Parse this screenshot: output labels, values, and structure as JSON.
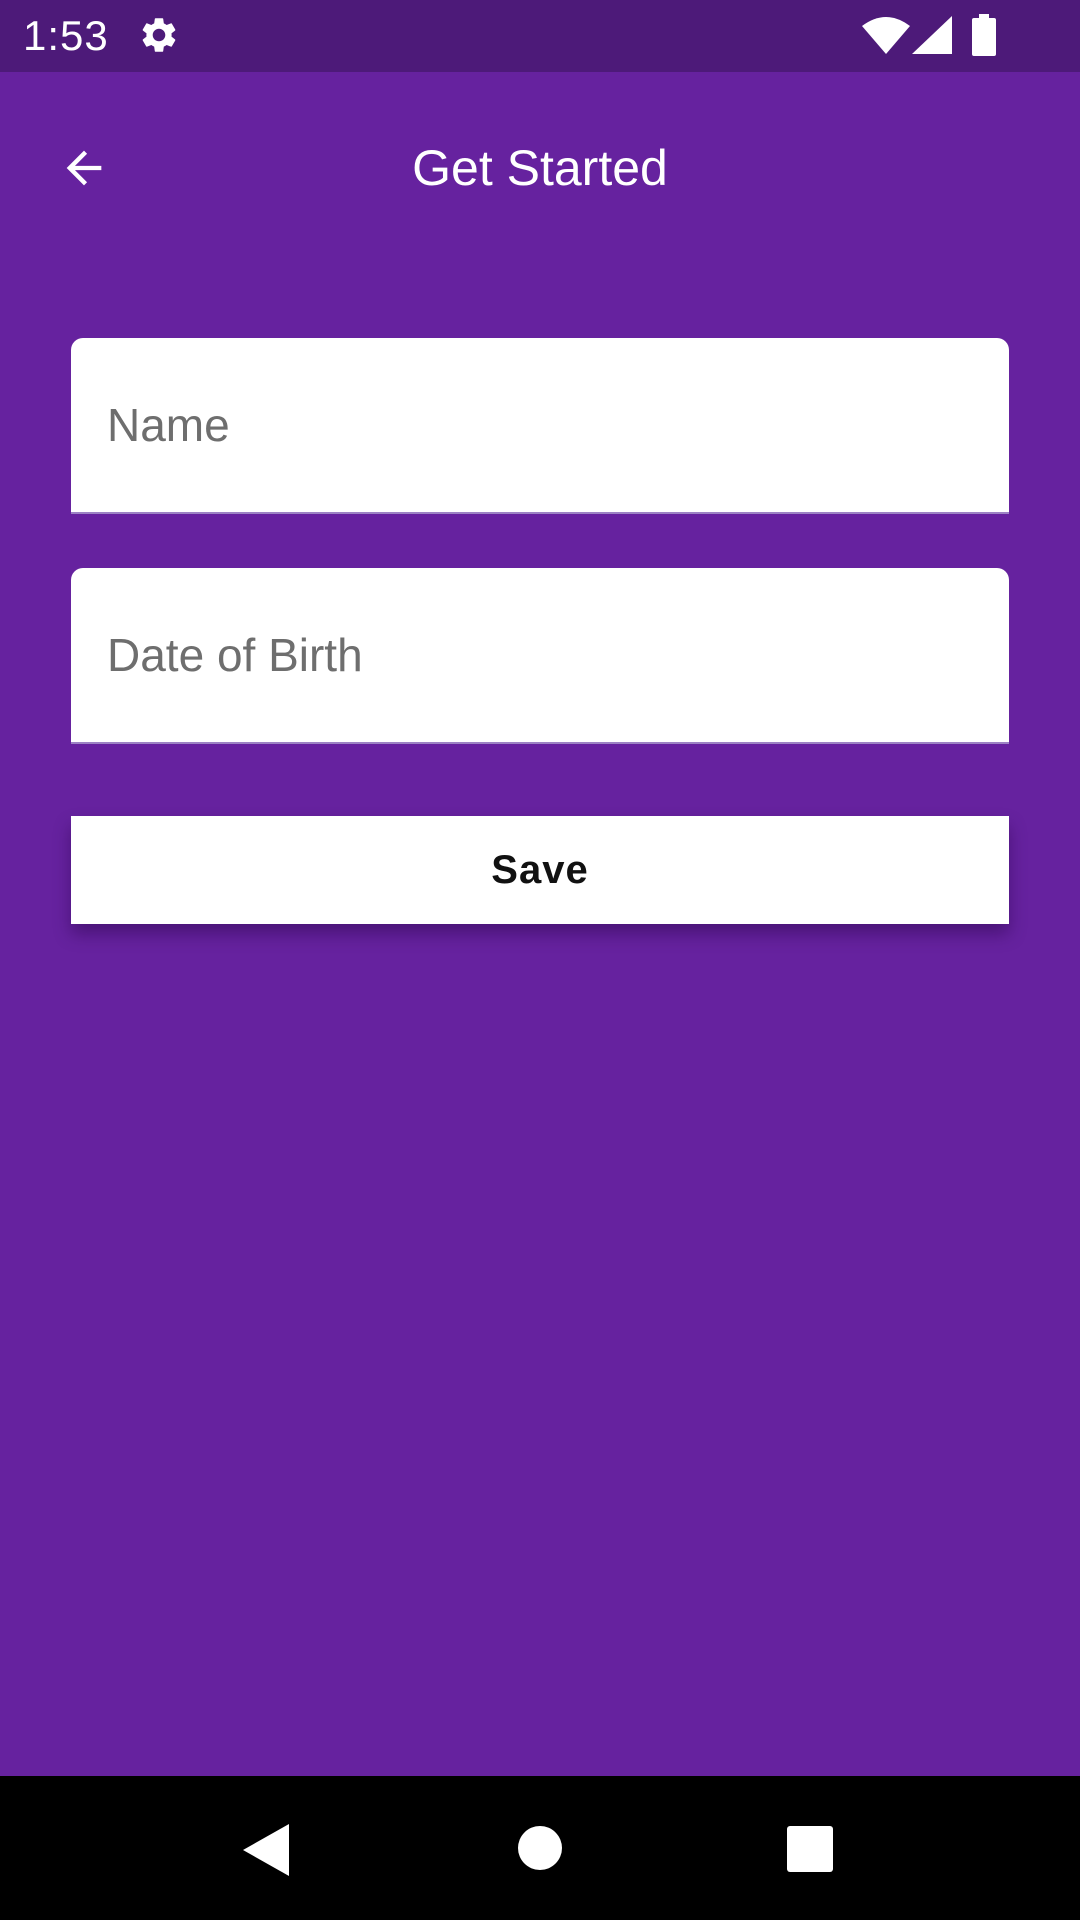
{
  "status_bar": {
    "time": "1:53",
    "icons": [
      "gear-icon",
      "wifi-icon",
      "signal-icon",
      "battery-icon"
    ]
  },
  "app_bar": {
    "title": "Get Started",
    "back_icon": "arrow-back-icon"
  },
  "form": {
    "name_placeholder": "Name",
    "name_value": "",
    "dob_placeholder": "Date of Birth",
    "dob_value": "",
    "save_label": "Save"
  },
  "nav_bar": {
    "icons": [
      "nav-back-icon",
      "nav-home-icon",
      "nav-recents-icon"
    ]
  },
  "colors": {
    "background": "#66229f",
    "status_bar": "#4d1a79",
    "nav_bar": "#000000",
    "field_background": "#ffffff"
  }
}
